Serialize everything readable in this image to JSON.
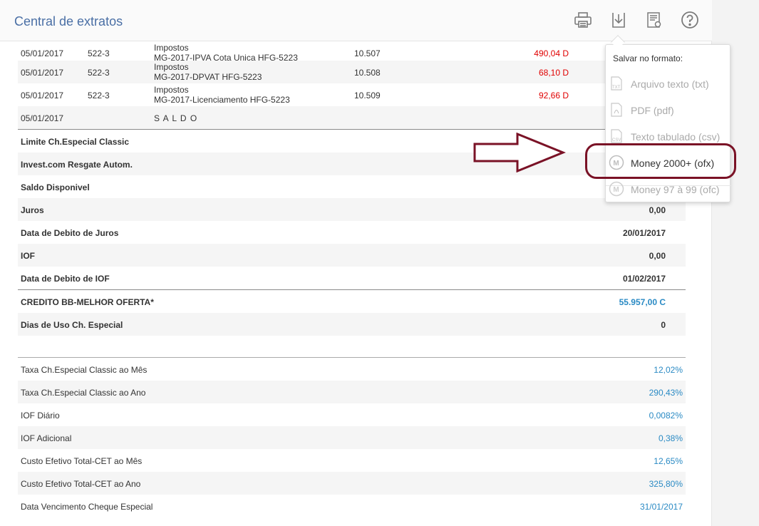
{
  "header": {
    "title": "Central de extratos",
    "icons": [
      "printer-icon",
      "download-icon",
      "receipt-icon",
      "help-icon"
    ]
  },
  "transactions": [
    {
      "date": "05/01/2017",
      "branch": "522-3",
      "desc1": "Impostos",
      "desc2": "MG-2017-IPVA Cota Unica HFG-5223",
      "doc": "10.507",
      "value": "490,04 D"
    },
    {
      "date": "05/01/2017",
      "branch": "522-3",
      "desc1": "Impostos",
      "desc2": "MG-2017-DPVAT HFG-5223",
      "doc": "10.508",
      "value": "68,10 D"
    },
    {
      "date": "05/01/2017",
      "branch": "522-3",
      "desc1": "Impostos",
      "desc2": "MG-2017-Licenciamento HFG-5223",
      "doc": "10.509",
      "value": "92,66 D"
    }
  ],
  "saldo_row": {
    "date": "05/01/2017",
    "label": "S A L D O"
  },
  "summary": [
    {
      "label": "Limite Ch.Especial Classic",
      "value": ""
    },
    {
      "label": "Invest.com Resgate Autom.",
      "value": ""
    },
    {
      "label": "Saldo Disponivel",
      "value": ""
    },
    {
      "label": "Juros",
      "value": "0,00"
    },
    {
      "label": "Data de Debito de Juros",
      "value": "20/01/2017"
    },
    {
      "label": "IOF",
      "value": "0,00"
    },
    {
      "label": "Data de Debito de IOF",
      "value": "01/02/2017"
    }
  ],
  "credit_row": {
    "label": "CREDITO BB-MELHOR OFERTA*",
    "value": "55.957,00 C"
  },
  "dias_row": {
    "label": "Dias de Uso Ch. Especial",
    "value": "0"
  },
  "rates": [
    {
      "label": "Taxa Ch.Especial Classic ao Mês",
      "value": "12,02%"
    },
    {
      "label": "Taxa Ch.Especial Classic ao Ano",
      "value": "290,43%"
    },
    {
      "label": "IOF Diário",
      "value": "0,0082%"
    },
    {
      "label": "IOF Adicional",
      "value": "0,38%"
    },
    {
      "label": "Custo Efetivo Total-CET ao Mês",
      "value": "12,65%"
    },
    {
      "label": "Custo Efetivo Total-CET ao Ano",
      "value": "325,80%"
    },
    {
      "label": "Data Vencimento Cheque Especial",
      "value": "31/01/2017"
    }
  ],
  "dropdown": {
    "title": "Salvar no formato:",
    "items": [
      {
        "label": "Arquivo texto (txt)",
        "icon": "txt-file-icon"
      },
      {
        "label": "PDF (pdf)",
        "icon": "pdf-file-icon"
      },
      {
        "label": "Texto tabulado (csv)",
        "icon": "csv-file-icon"
      },
      {
        "label": "Money 2000+ (ofx)",
        "icon": "money-icon"
      },
      {
        "label": "Money 97 à 99 (ofc)",
        "icon": "money-icon"
      }
    ]
  },
  "colors": {
    "title": "#4a6fa5",
    "negative": "#e00000",
    "positive": "#2a8ac4",
    "annotation": "#7a1226"
  }
}
